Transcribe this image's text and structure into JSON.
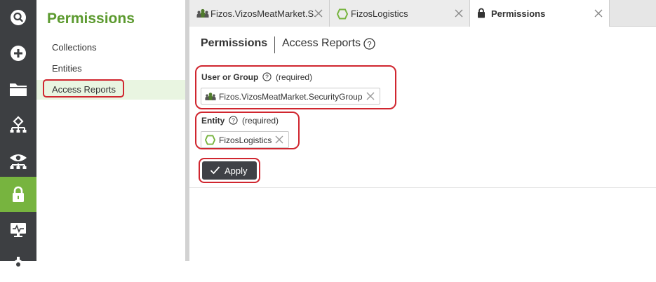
{
  "rail": {
    "items": [
      {
        "icon": "search-icon"
      },
      {
        "icon": "add-icon"
      },
      {
        "icon": "folder-icon"
      },
      {
        "icon": "hierarchy-icon"
      },
      {
        "icon": "view-icon"
      },
      {
        "icon": "lock-icon",
        "active": true
      },
      {
        "icon": "monitor-icon"
      },
      {
        "icon": "settings-icon"
      }
    ],
    "active_color": "#77b43f",
    "bg_color": "#3d3f42"
  },
  "nav": {
    "title": "Permissions",
    "items": [
      {
        "label": "Collections"
      },
      {
        "label": "Entities"
      },
      {
        "label": "Access Reports",
        "selected": true
      }
    ],
    "title_color": "#5c9a2f"
  },
  "tabs": [
    {
      "label": "Fizos.VizosMeatMarket.S...",
      "icon": "group-icon"
    },
    {
      "label": "FizosLogistics",
      "icon": "entity-hexagon-icon"
    },
    {
      "label": "Permissions",
      "icon": "lock-icon",
      "active": true
    }
  ],
  "main": {
    "title": "Permissions",
    "subtitle": "Access Reports",
    "user_group": {
      "label": "User or Group",
      "required": "(required)",
      "value": "Fizos.VizosMeatMarket.SecurityGroup"
    },
    "entity": {
      "label": "Entity",
      "required": "(required)",
      "value": "FizosLogistics"
    },
    "apply_label": "Apply",
    "highlight_color": "#d0262f"
  }
}
